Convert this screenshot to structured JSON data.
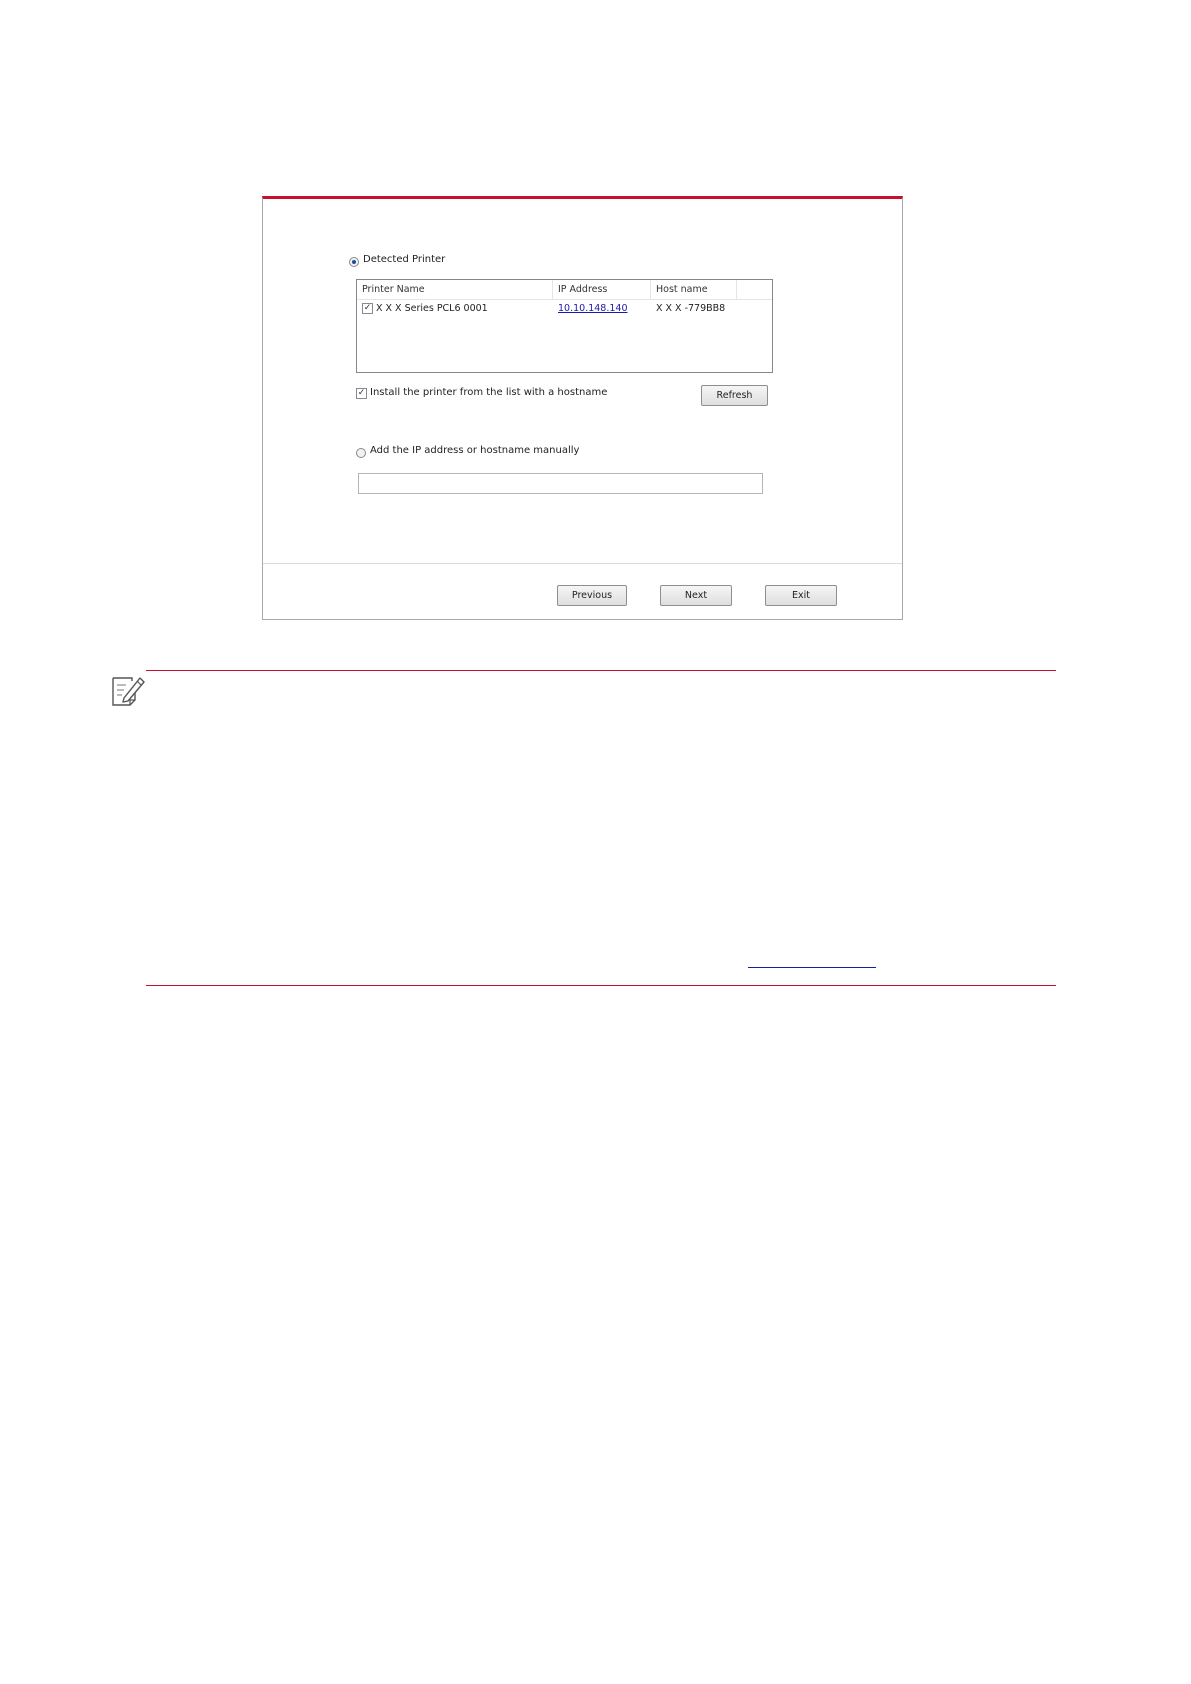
{
  "dialog": {
    "detected_printer_label": "Detected Printer",
    "columns": [
      "Printer Name",
      "IP Address",
      "Host name"
    ],
    "printers": [
      {
        "checked": true,
        "name": "X X X  Series PCL6 0001",
        "ip": "10.10.148.140",
        "host": "X X X -779BB8"
      }
    ],
    "install_hostname_label": "Install the printer from the list with a hostname",
    "install_hostname_checked": true,
    "refresh_label": "Refresh",
    "manual_label": "Add the IP address or hostname manually",
    "manual_value": "",
    "previous_label": "Previous",
    "next_label": "Next",
    "exit_label": "Exit",
    "check_mark": "✓"
  },
  "colors": {
    "accent_red": "#c8102e",
    "link_blue": "#1a1aa8"
  },
  "icons": {
    "note": "note-pencil-icon"
  }
}
